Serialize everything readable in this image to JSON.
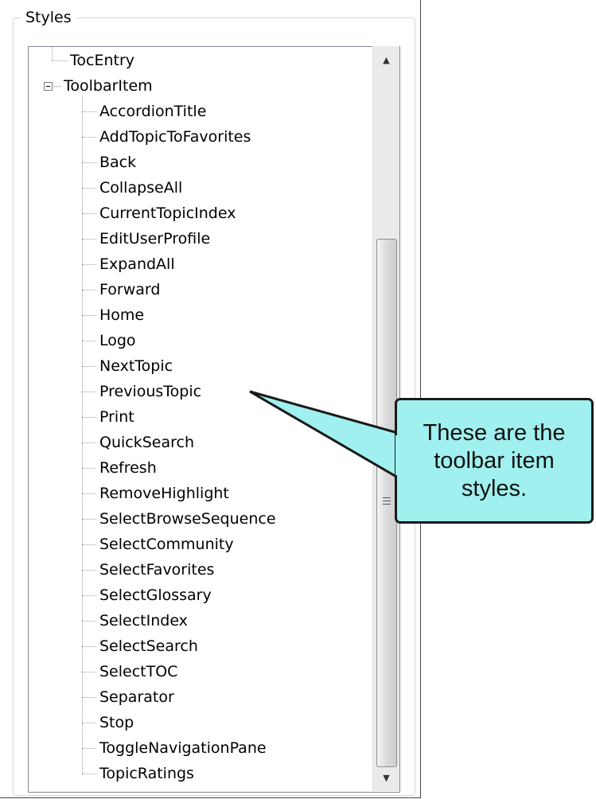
{
  "groupbox": {
    "title": "Styles"
  },
  "tree": {
    "top_item": "TocEntry",
    "parent": "ToolbarItem",
    "children": [
      "AccordionTitle",
      "AddTopicToFavorites",
      "Back",
      "CollapseAll",
      "CurrentTopicIndex",
      "EditUserProfile",
      "ExpandAll",
      "Forward",
      "Home",
      "Logo",
      "NextTopic",
      "PreviousTopic",
      "Print",
      "QuickSearch",
      "Refresh",
      "RemoveHighlight",
      "SelectBrowseSequence",
      "SelectCommunity",
      "SelectFavorites",
      "SelectGlossary",
      "SelectIndex",
      "SelectSearch",
      "SelectTOC",
      "Separator",
      "Stop",
      "ToggleNavigationPane",
      "TopicRatings"
    ]
  },
  "scrollbar": {
    "up_icon": "up-arrow-icon",
    "down_icon": "down-arrow-icon"
  },
  "callout": {
    "text": "These are the toolbar item styles.",
    "color": "#9ff0ee"
  }
}
